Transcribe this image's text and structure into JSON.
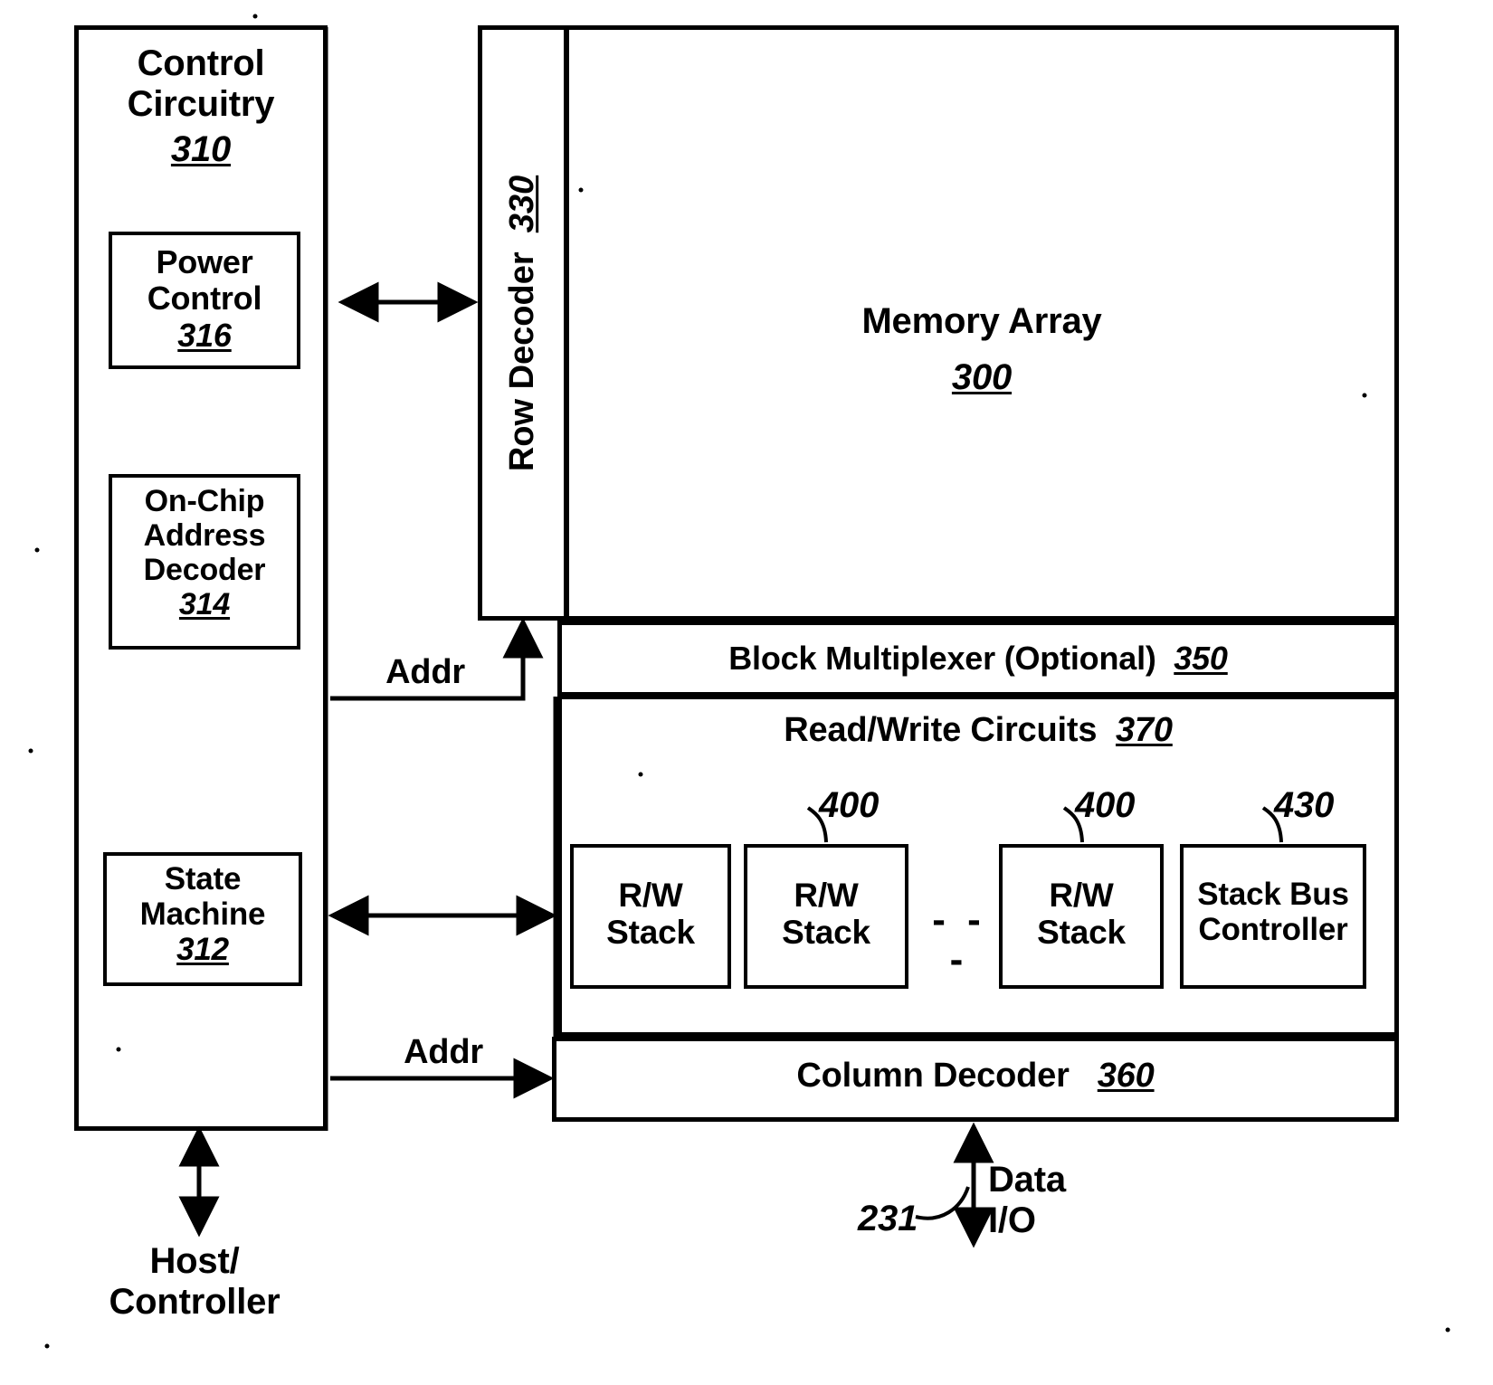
{
  "figure": {
    "title": "Memory device block diagram",
    "style": {
      "ink": "#000000",
      "paper": "#ffffff"
    }
  },
  "control_circuitry": {
    "title_line1": "Control",
    "title_line2": "Circuitry",
    "ref": "310",
    "power_control": {
      "line1": "Power",
      "line2": "Control",
      "ref": "316"
    },
    "address_decoder": {
      "line1": "On-Chip",
      "line2": "Address",
      "line3": "Decoder",
      "ref": "314"
    },
    "state_machine": {
      "line1": "State",
      "line2": "Machine",
      "ref": "312"
    }
  },
  "row_decoder": {
    "label": "Row Decoder",
    "ref": "330"
  },
  "memory_array": {
    "label": "Memory Array",
    "ref": "300"
  },
  "block_multiplexer": {
    "label": "Block Multiplexer (Optional)",
    "ref": "350"
  },
  "read_write_circuits": {
    "label": "Read/Write Circuits",
    "ref": "370",
    "stacks": [
      {
        "line1": "R/W",
        "line2": "Stack",
        "ref": ""
      },
      {
        "line1": "R/W",
        "line2": "Stack",
        "ref": "400"
      },
      {
        "line1": "R/W",
        "line2": "Stack",
        "ref": "400"
      }
    ],
    "ellipsis": "- - -",
    "stack_bus_controller": {
      "line1": "Stack Bus",
      "line2": "Controller",
      "ref": "430"
    }
  },
  "column_decoder": {
    "label": "Column Decoder",
    "ref": "360"
  },
  "connections": {
    "addr_upper": "Addr",
    "addr_lower": "Addr",
    "data_io_line1": "Data",
    "data_io_line2": "I/O",
    "data_io_ref": "231",
    "host_line1": "Host/",
    "host_line2": "Controller"
  }
}
